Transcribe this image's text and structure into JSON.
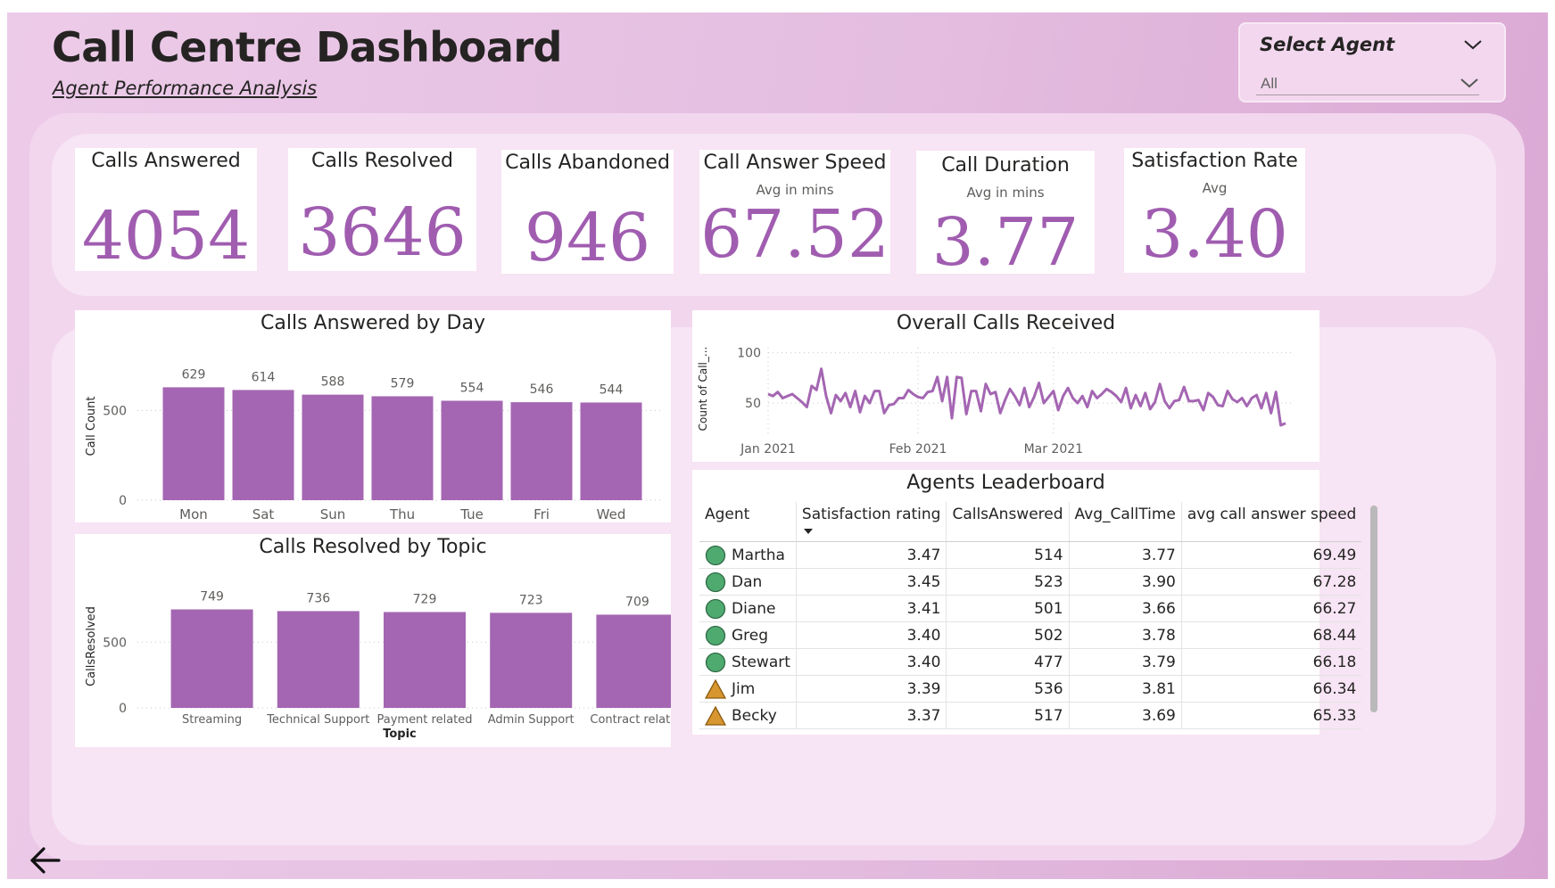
{
  "header": {
    "title": "Call Centre Dashboard",
    "subtitle": "Agent Performance Analysis"
  },
  "slicer": {
    "title": "Select Agent",
    "value": "All"
  },
  "kpis": [
    {
      "title": "Calls Answered",
      "sub": "",
      "value": "4054"
    },
    {
      "title": "Calls Resolved",
      "sub": "",
      "value": "3646"
    },
    {
      "title": "Calls Abandoned",
      "sub": "",
      "value": "946"
    },
    {
      "title": "Call Answer Speed",
      "sub": "Avg in mins",
      "value": "67.52"
    },
    {
      "title": "Call Duration",
      "sub": "Avg in mins",
      "value": "3.77"
    },
    {
      "title": "Satisfaction Rate",
      "sub": "Avg",
      "value": "3.40"
    }
  ],
  "chart_data": [
    {
      "type": "bar",
      "title": "Calls Answered by Day",
      "xlabel": "",
      "ylabel": "Call Count",
      "categories": [
        "Mon",
        "Sat",
        "Sun",
        "Thu",
        "Tue",
        "Fri",
        "Wed"
      ],
      "values": [
        629,
        614,
        588,
        579,
        554,
        546,
        544
      ],
      "yticks": [
        0,
        500
      ],
      "ylim": [
        0,
        780
      ],
      "grid": true
    },
    {
      "type": "bar",
      "title": "Calls Resolved by Topic",
      "xlabel": "Topic",
      "ylabel": "CallsResolved",
      "categories": [
        "Streaming",
        "Technical Support",
        "Payment related",
        "Admin Support",
        "Contract related"
      ],
      "values": [
        749,
        736,
        729,
        723,
        709
      ],
      "yticks": [
        0,
        500
      ],
      "ylim": [
        0,
        800
      ],
      "grid": true
    },
    {
      "type": "line",
      "title": "Overall Calls Received",
      "xlabel": "",
      "ylabel": "Count of Call_...",
      "x_ticks": [
        "Jan 2021",
        "Feb 2021",
        "Mar 2021"
      ],
      "yticks": [
        50,
        100
      ],
      "ylim": [
        20,
        105
      ],
      "x_start": "2021-01-01",
      "values": [
        59,
        57,
        61,
        55,
        57,
        59,
        55,
        51,
        46,
        67,
        63,
        84,
        57,
        40,
        58,
        52,
        60,
        46,
        62,
        41,
        57,
        50,
        62,
        62,
        40,
        48,
        49,
        55,
        55,
        63,
        59,
        56,
        55,
        61,
        62,
        76,
        52,
        76,
        35,
        76,
        75,
        39,
        62,
        62,
        42,
        69,
        59,
        61,
        40,
        53,
        64,
        57,
        48,
        65,
        46,
        56,
        70,
        50,
        56,
        62,
        43,
        57,
        65,
        55,
        50,
        57,
        46,
        62,
        55,
        59,
        64,
        61,
        57,
        51,
        65,
        45,
        58,
        47,
        60,
        44,
        51,
        69,
        52,
        45,
        52,
        53,
        66,
        52,
        52,
        53,
        43,
        60,
        56,
        48,
        47,
        62,
        54,
        51,
        55,
        47,
        55,
        58,
        45,
        60,
        40,
        61,
        28,
        30
      ]
    }
  ],
  "overall_calls": {
    "title": "Overall Calls Received"
  },
  "leaderboard": {
    "title": "Agents Leaderboard",
    "columns": [
      "Agent",
      "Satisfaction rating",
      "CallsAnswered",
      "Avg_CallTime",
      "avg call answer speed"
    ],
    "rows": [
      {
        "agent": "Martha",
        "indicator": "green-circle-icon",
        "satisfaction": "3.47",
        "calls": "514",
        "avg_time": "3.77",
        "speed": "69.49"
      },
      {
        "agent": "Dan",
        "indicator": "green-circle-icon",
        "satisfaction": "3.45",
        "calls": "523",
        "avg_time": "3.90",
        "speed": "67.28"
      },
      {
        "agent": "Diane",
        "indicator": "green-circle-icon",
        "satisfaction": "3.41",
        "calls": "501",
        "avg_time": "3.66",
        "speed": "66.27"
      },
      {
        "agent": "Greg",
        "indicator": "green-circle-icon",
        "satisfaction": "3.40",
        "calls": "502",
        "avg_time": "3.78",
        "speed": "68.44"
      },
      {
        "agent": "Stewart",
        "indicator": "green-circle-icon",
        "satisfaction": "3.40",
        "calls": "477",
        "avg_time": "3.79",
        "speed": "66.18"
      },
      {
        "agent": "Jim",
        "indicator": "orange-triangle-icon",
        "satisfaction": "3.39",
        "calls": "536",
        "avg_time": "3.81",
        "speed": "66.34"
      },
      {
        "agent": "Becky",
        "indicator": "orange-triangle-icon",
        "satisfaction": "3.37",
        "calls": "517",
        "avg_time": "3.69",
        "speed": "65.33"
      }
    ]
  },
  "colors": {
    "accent": "#a05db0",
    "bar": "#a466b2",
    "good": "#4faa6f",
    "warn": "#d7962f"
  }
}
